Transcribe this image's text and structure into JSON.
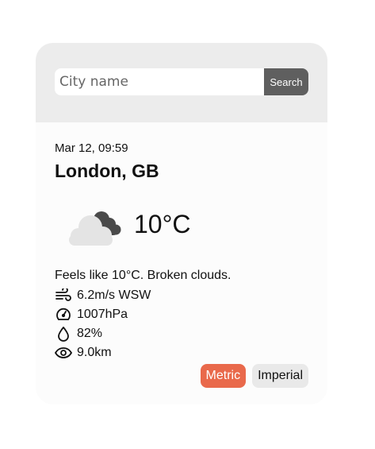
{
  "search": {
    "placeholder": "City name",
    "value": "",
    "button_label": "Search"
  },
  "weather": {
    "datetime": "Mar 12, 09:59",
    "location": "London, GB",
    "temperature": "10°C",
    "icon": "broken-clouds-icon",
    "description": "Feels like 10°C. Broken clouds.",
    "details": [
      {
        "icon": "wind-icon",
        "text": "6.2m/s WSW"
      },
      {
        "icon": "pressure-gauge-icon",
        "text": "1007hPa"
      },
      {
        "icon": "humidity-drop-icon",
        "text": "82%"
      },
      {
        "icon": "visibility-eye-icon",
        "text": "9.0km"
      }
    ]
  },
  "units": {
    "metric_label": "Metric",
    "imperial_label": "Imperial",
    "selected": "Metric"
  },
  "colors": {
    "accent": "#e9694b",
    "search_button": "#5f5f5f",
    "header_bg": "#ececec"
  }
}
